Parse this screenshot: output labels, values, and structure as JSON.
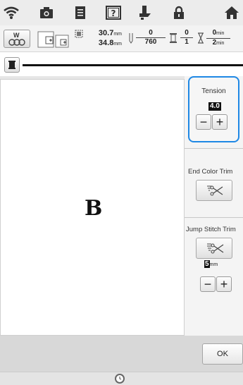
{
  "top_icons": [
    "wifi-icon",
    "camera-icon",
    "document-icon",
    "help-icon",
    "presser-foot-icon",
    "lock-icon",
    "home-icon"
  ],
  "info": {
    "width": "30.7",
    "height": "34.8",
    "unit": "mm",
    "stitch_current": "0",
    "stitch_total": "760",
    "color_current": "0",
    "color_total": "1",
    "time_current": "0",
    "time_total": "2",
    "time_unit": "min"
  },
  "panel": {
    "tension_label": "Tension",
    "tension_value": "4.0",
    "end_color_trim_label": "End Color Trim",
    "jump_stitch_trim_label": "Jump Stitch Trim",
    "jump_value": "5",
    "jump_unit": "mm"
  },
  "preview": {
    "design_letter": "B"
  },
  "ok_label": "OK",
  "accent_color": "#1e88e5"
}
